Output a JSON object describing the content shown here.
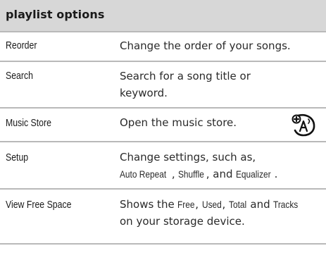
{
  "header": {
    "title": "playlist options"
  },
  "rows": [
    {
      "term": "Reorder",
      "desc": [
        "Change the order of your songs."
      ]
    },
    {
      "term": "Search",
      "desc": [
        "Search for a song title or",
        "keyword."
      ]
    },
    {
      "term": "Music Store",
      "desc": [
        "Open the music store."
      ],
      "icon": "voice-command-icon"
    },
    {
      "term": "Setup",
      "desc_line1": "Change settings, such as,",
      "desc_line2": {
        "a": "Auto Repeat",
        "sep1": ", ",
        "b": "Shuffle",
        "sep2": ", and ",
        "c": "Equalizer",
        "end": "."
      }
    },
    {
      "term": "View Free Space",
      "desc_line1": {
        "pre": "Shows the ",
        "a": "Free",
        "sep1": ", ",
        "b": "Used",
        "sep2": ", ",
        "c": "Total",
        "sep3": " and ",
        "d": "Tracks"
      },
      "desc_line2": "on your storage device."
    }
  ],
  "colors": {
    "header_bg": "#d7d7d7",
    "rule": "#b9b9b9",
    "text": "#1a1a1a"
  }
}
